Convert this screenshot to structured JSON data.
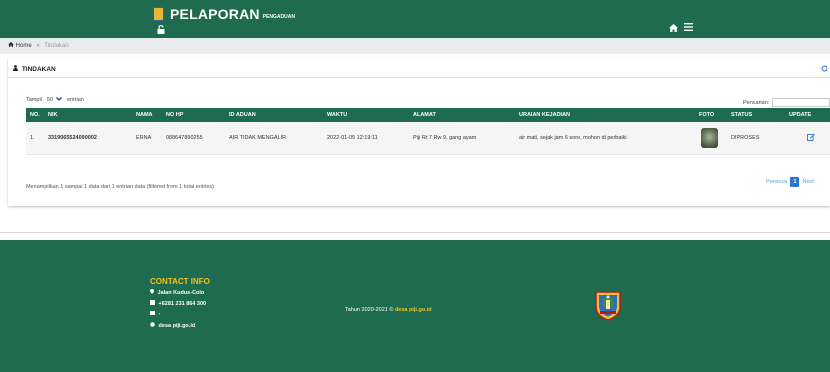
{
  "header": {
    "title": "PELAPORAN",
    "subtitle": "PENGADUAN",
    "unlock_icon": "unlock-icon",
    "home_icon": "home-icon",
    "menu_icon": "bars-icon"
  },
  "breadcrumb": {
    "home": "Home",
    "separator": "»",
    "current": "Tindakan"
  },
  "panel": {
    "title": "TINDAKAN",
    "refresh_icon": "refresh-icon"
  },
  "table_controls": {
    "show_label": "Tampil",
    "page_length": "50",
    "entries_label": "entrian",
    "search_label": "Pencarian:"
  },
  "table": {
    "columns": [
      "NO.",
      "NIK",
      "NAMA",
      "NO HP",
      "ID ADUAN",
      "WAKTU",
      "ALAMAT",
      "URAIAN KEJADIAN",
      "FOTO",
      "STATUS",
      "UPDATE"
    ],
    "rows": [
      {
        "no": "1.",
        "nik": "3319065524090002",
        "nama": "ERNA",
        "no_hp": "088647890255",
        "id_aduan": "AIR TIDAK MENGALIR",
        "waktu": "2022-01-05 12:19:11",
        "alamat": "Piji Rt 7 Rw 9, gang ayam",
        "uraian": "air mati, sejak jam 6 sore, mohon di perbaiki",
        "status": "DIPROSES"
      }
    ]
  },
  "table_info": "Menampilkan 1 sampai 1 data dari 1 entrian data (filtered from 1 total entries)",
  "pagination": {
    "previous": "Previous",
    "current": "1",
    "next": "Next"
  },
  "footer": {
    "contact_title": "CONTACT INFO",
    "address": "Jalan Kudus-Colo",
    "phone": "+6281 231 864 300",
    "email": "-",
    "website": "desa piji.go.id",
    "copyright_text": "Tahun 2020-2021 ©",
    "copyright_site": "desa piji.go.id"
  },
  "colors": {
    "primary_green": "#1e6b4f",
    "accent_yellow": "#f2c21b",
    "link_blue": "#2c76c9"
  }
}
